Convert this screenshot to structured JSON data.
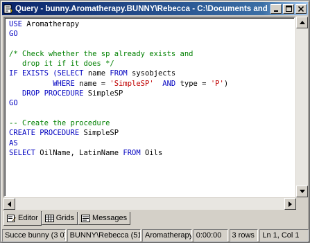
{
  "window": {
    "title": "Query - bunny.Aromatherapy.BUNNY\\Rebecca - C:\\Documents and Se...",
    "title_icon": "query-window-icon",
    "minimize_glyph": "_",
    "maximize_glyph": "□",
    "close_glyph": "×"
  },
  "editor": {
    "lines": [
      [
        {
          "t": "USE ",
          "c": "kw"
        },
        {
          "t": "Aromatherapy",
          "c": "plain"
        }
      ],
      [
        {
          "t": "GO",
          "c": "kw"
        }
      ],
      [
        {
          "t": "",
          "c": "plain"
        }
      ],
      [
        {
          "t": "/* Check whether the sp already exists and",
          "c": "cmt"
        }
      ],
      [
        {
          "t": "   drop it if it does */",
          "c": "cmt"
        }
      ],
      [
        {
          "t": "IF ",
          "c": "kw"
        },
        {
          "t": "EXISTS (",
          "c": "kw"
        },
        {
          "t": "SELECT ",
          "c": "kw"
        },
        {
          "t": "name ",
          "c": "plain"
        },
        {
          "t": "FROM ",
          "c": "kw"
        },
        {
          "t": "sysobjects",
          "c": "plain"
        }
      ],
      [
        {
          "t": "          WHERE ",
          "c": "kw"
        },
        {
          "t": "name = ",
          "c": "plain"
        },
        {
          "t": "'SimpleSP'",
          "c": "str"
        },
        {
          "t": "  AND ",
          "c": "kw"
        },
        {
          "t": "type = ",
          "c": "plain"
        },
        {
          "t": "'P'",
          "c": "str"
        },
        {
          "t": ")",
          "c": "plain"
        }
      ],
      [
        {
          "t": "   DROP PROCEDURE ",
          "c": "kw"
        },
        {
          "t": "SimpleSP",
          "c": "plain"
        }
      ],
      [
        {
          "t": "GO",
          "c": "kw"
        }
      ],
      [
        {
          "t": "",
          "c": "plain"
        }
      ],
      [
        {
          "t": "-- Create the procedure",
          "c": "cmt"
        }
      ],
      [
        {
          "t": "CREATE PROCEDURE ",
          "c": "kw"
        },
        {
          "t": "SimpleSP",
          "c": "plain"
        }
      ],
      [
        {
          "t": "AS",
          "c": "kw"
        }
      ],
      [
        {
          "t": "SELECT ",
          "c": "kw"
        },
        {
          "t": "OilName, LatinName ",
          "c": "plain"
        },
        {
          "t": "FROM ",
          "c": "kw"
        },
        {
          "t": "Oils",
          "c": "plain"
        }
      ]
    ]
  },
  "tabs": [
    {
      "label": "Editor",
      "icon": "editor-pencil-icon",
      "active": true
    },
    {
      "label": "Grids",
      "icon": "grid-icon",
      "active": false
    },
    {
      "label": "Messages",
      "icon": "messages-icon",
      "active": false
    }
  ],
  "statusbar": {
    "status": "Succe bunny (3 0)",
    "user": "BUNNY\\Rebecca (51(",
    "database": "Aromatherapy",
    "time": "0:00:00",
    "rows": "3 rows",
    "position": "Ln 1, Col 1"
  },
  "colors": {
    "keyword": "#0000c0",
    "string": "#c00000",
    "comment": "#008000",
    "titlebar_start": "#0a246a",
    "titlebar_end": "#a6caf0"
  }
}
